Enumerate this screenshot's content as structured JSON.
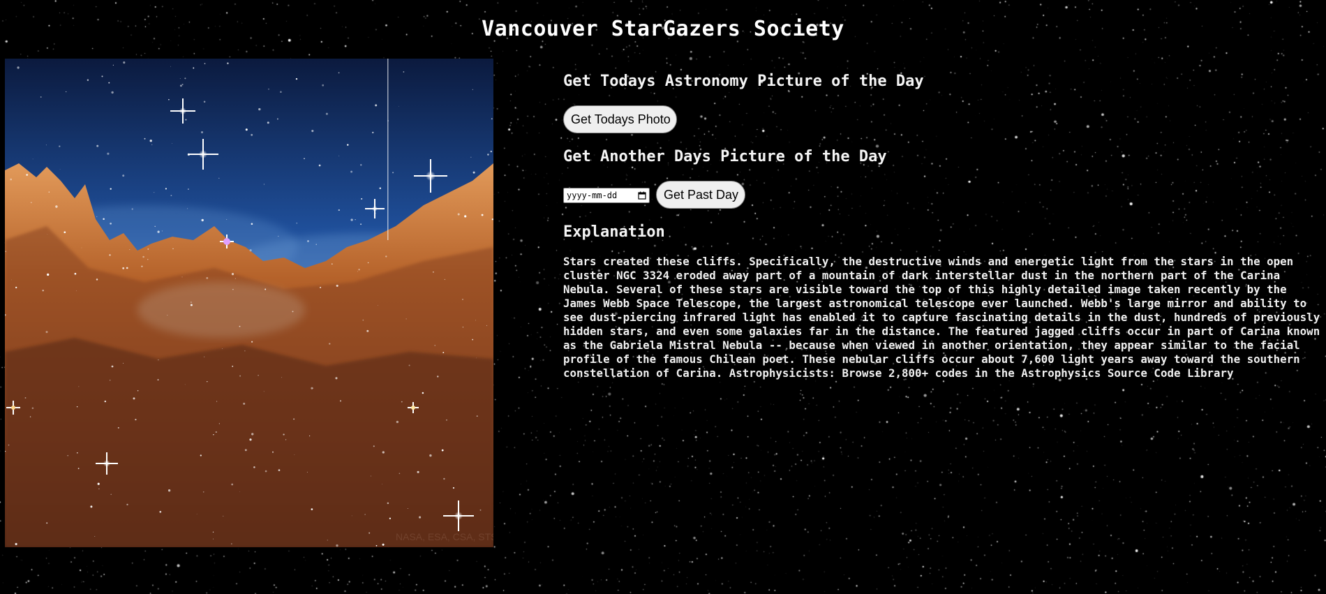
{
  "header": {
    "title": "Vancouver StarGazers Society"
  },
  "today_section": {
    "heading": "Get Todays Astronomy Picture of the Day",
    "button_label": "Get Todays Photo"
  },
  "past_section": {
    "heading": "Get Another Days Picture of the Day",
    "date_placeholder": "yyyy-mm-dd",
    "button_label": "Get Past Day"
  },
  "explanation_section": {
    "heading": "Explanation",
    "text": "Stars created these cliffs. Specifically, the destructive winds and energetic light from the stars in the open cluster NGC 3324 eroded away part of a mountain of dark interstellar dust in the northern part of the Carina Nebula. Several of these stars are visible toward the top of this highly detailed image taken recently by the James Webb Space Telescope, the largest astronomical telescope ever launched. Webb's large mirror and ability to see dust-piercing infrared light has enabled it to capture fascinating details in the dust, hundreds of previously hidden stars, and even some galaxies far in the distance. The featured jagged cliffs occur in part of Carina known as the Gabriela Mistral Nebula -- because when viewed in another orientation, they appear similar to the facial profile of the famous Chilean poet. These nebular cliffs occur about 7,600 light years away toward the southern constellation of Carina. Astrophysicists: Browse 2,800+ codes in the Astrophysics Source Code Library"
  },
  "image": {
    "credit_watermark": "NASA, ESA, CSA, STScI"
  },
  "icons": {
    "date_picker": "calendar-icon"
  },
  "colors": {
    "background": "#000000",
    "text": "#f2f2f2",
    "button_bg": "#efefef",
    "nebula_sky": "#1f4f9a",
    "nebula_cliffs": "#b5622a"
  }
}
